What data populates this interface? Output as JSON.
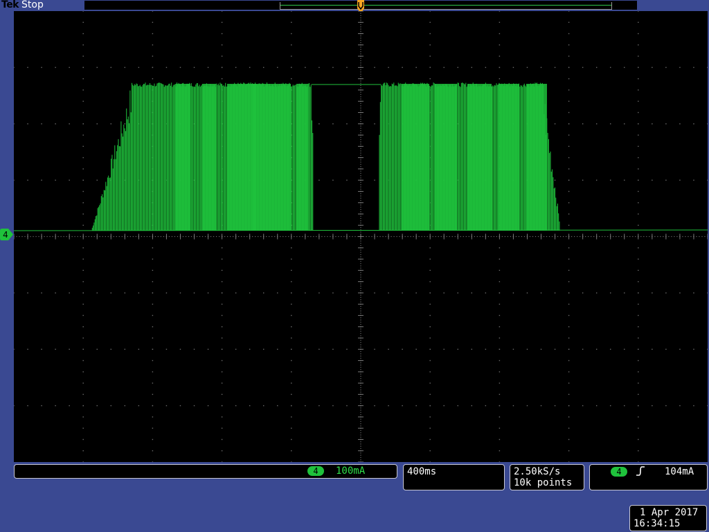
{
  "header": {
    "brand": "Tek",
    "run_state": "Stop"
  },
  "channel": {
    "number": "4",
    "scale": "100mA",
    "trace_color": "#1fc23c"
  },
  "timebase": {
    "per_division": "400ms"
  },
  "acquisition": {
    "sample_rate": "2.50kS/s",
    "record_length": "10k points"
  },
  "trigger": {
    "source": "4",
    "slope": "rising-edge-icon",
    "level": "104mA"
  },
  "timestamp": {
    "date": "1 Apr 2017",
    "time": "16:34:15"
  },
  "colors": {
    "background": "#3a4992",
    "screen": "#000000",
    "trace": "#1fc23c",
    "trigger_marker": "#f5a623"
  }
}
